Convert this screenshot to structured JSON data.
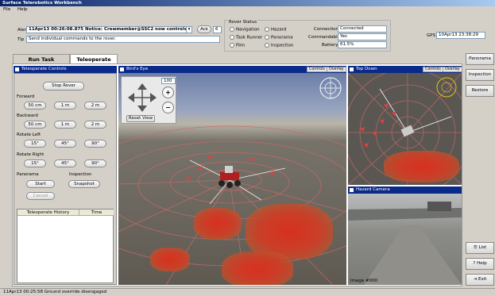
{
  "app": {
    "title": "Surface Telerobotics Workbench"
  },
  "menu": [
    "File",
    "Help"
  ],
  "alert": {
    "label": "Alert",
    "value": "11Apr13 00:26:08.875  Notice: Crewmember@SSC2 now controls robot",
    "ack_label": "Ack",
    "ack_count": "6"
  },
  "tip": {
    "label": "Tip",
    "value": "Send individual commands to the rover."
  },
  "rover_status": {
    "title": "Rover Status",
    "modes": [
      "Navigation",
      "Task Runner",
      "Film",
      "Hazard",
      "Panorama",
      "Inspection"
    ],
    "connection_label": "Connection",
    "connection_value": "Connected",
    "commandable_label": "Commandable",
    "commandable_value": "Yes",
    "battery_label": "Battery",
    "battery_value": "61.5%"
  },
  "gps": {
    "label": "GPS",
    "value": "10Apr13 23:38:29"
  },
  "tabs": [
    "Run Task Sequence",
    "Teleoperate"
  ],
  "teleop": {
    "title": "Teleoperate Controls",
    "stop": "Stop Rover",
    "forward_label": "Forward",
    "forward": [
      "50 cm",
      "1 m",
      "2 m"
    ],
    "backward_label": "Backward",
    "backward": [
      "50 cm",
      "1 m",
      "2 m"
    ],
    "rotate_left_label": "Rotate Left",
    "rotate_left": [
      "15°",
      "45°",
      "90°"
    ],
    "rotate_right_label": "Rotate Right",
    "rotate_right": [
      "15°",
      "45°",
      "90°"
    ],
    "panorama_label": "Panorama",
    "start": "Start",
    "cancel": "Cancel",
    "inspection_label": "Inspection",
    "snapshot": "Snapshot",
    "history_col1": "Teleoperate History",
    "history_col2": "Time"
  },
  "birds_eye": {
    "title": "Bird's Eye",
    "controls": "Controls",
    "overlay": "Overlay",
    "zoom": "100",
    "reset": "Reset View"
  },
  "top_down": {
    "title": "Top Down",
    "controls": "Controls",
    "overlay": "Overlay"
  },
  "hazard": {
    "title": "Hazard Camera",
    "image_label": "Image #000"
  },
  "right_buttons": [
    "Panorama",
    "Inspection",
    "Restore"
  ],
  "bottom_buttons": [
    "List",
    "Help",
    "Exit"
  ],
  "status": "11Apr13 00:25:58  Ground override disengaged",
  "colors": {
    "title_blue": "#0a2a8a",
    "heat_red": "#d83020",
    "arrow_red": "#e04040",
    "sky": "#6c7ea8"
  }
}
